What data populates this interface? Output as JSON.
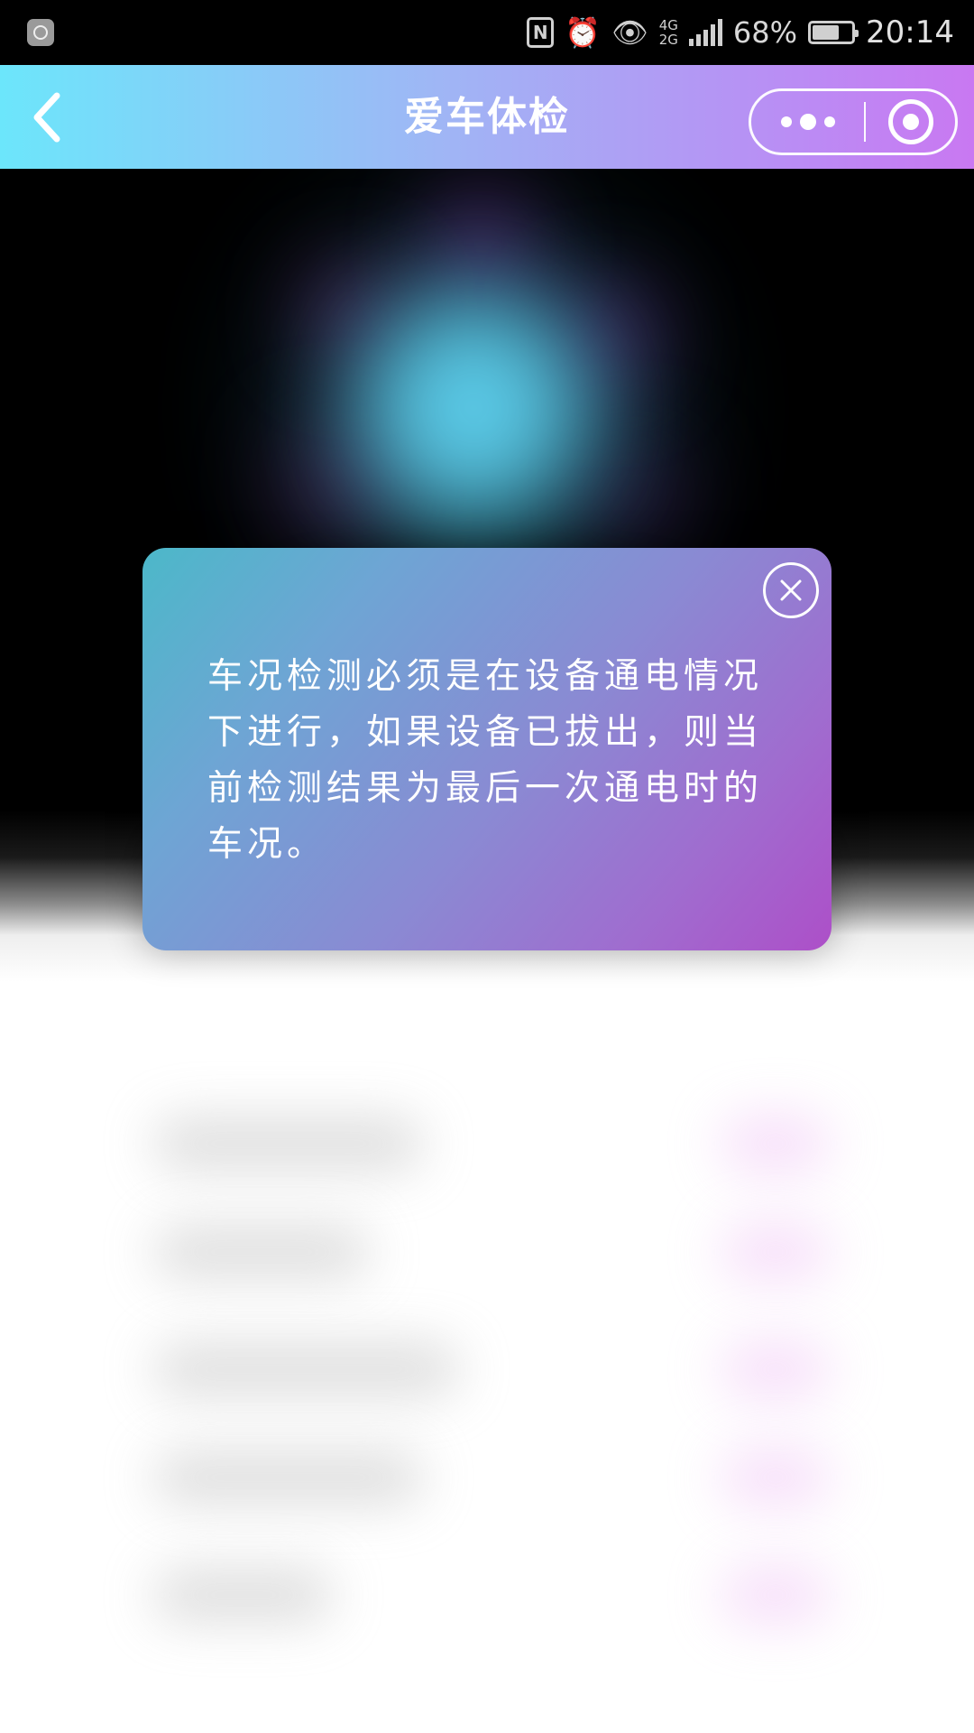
{
  "status_bar": {
    "battery_percent": "68%",
    "time": "20:14",
    "network_top": "4G",
    "network_bottom": "2G",
    "icons": [
      "notification-icon",
      "nfc-icon",
      "alarm-icon",
      "eye-comfort-icon",
      "signal-icon",
      "battery-icon"
    ]
  },
  "nav": {
    "title": "爱车体检",
    "back_icon": "chevron-left-icon",
    "more_icon": "more-dots-icon",
    "close_icon": "target-close-icon"
  },
  "dialog": {
    "message": "车况检测必须是在设备通电情况下进行，如果设备已拔出，则当前检测结果为最后一次通电时的车况。",
    "close_icon": "close-circle-icon"
  },
  "colors": {
    "nav_gradient_start": "#6ce6fb",
    "nav_gradient_end": "#c978f2",
    "dialog_gradient_start": "#4cb8c9",
    "dialog_gradient_end": "#ad4fc8",
    "glow": "#5fd2f0"
  }
}
